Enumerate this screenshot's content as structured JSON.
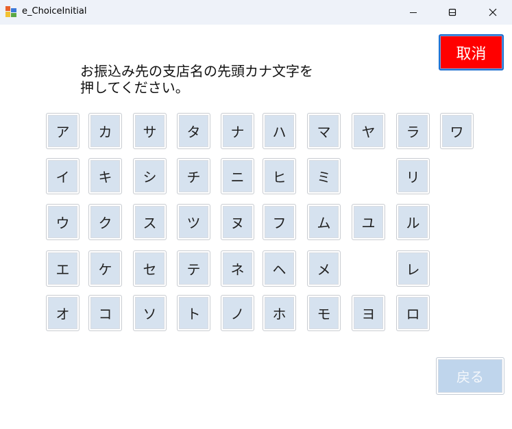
{
  "window": {
    "title": "e_ChoiceInitial"
  },
  "buttons": {
    "cancel": "取消",
    "back": "戻る"
  },
  "instruction": {
    "line1": "お振込み先の支店名の先頭カナ文字を",
    "line2": "押してください。"
  },
  "kana": {
    "a": "ア",
    "i": "イ",
    "u": "ウ",
    "e": "エ",
    "o": "オ",
    "ka": "カ",
    "ki": "キ",
    "ku": "ク",
    "ke": "ケ",
    "ko": "コ",
    "sa": "サ",
    "shi": "シ",
    "su": "ス",
    "se": "セ",
    "so": "ソ",
    "ta": "タ",
    "chi": "チ",
    "tsu": "ツ",
    "te": "テ",
    "to": "ト",
    "na": "ナ",
    "ni": "ニ",
    "nu": "ヌ",
    "ne": "ネ",
    "no": "ノ",
    "ha": "ハ",
    "hi": "ヒ",
    "fu": "フ",
    "he": "ヘ",
    "ho": "ホ",
    "ma": "マ",
    "mi": "ミ",
    "mu": "ム",
    "me": "メ",
    "mo": "モ",
    "ya": "ヤ",
    "yu": "ユ",
    "yo": "ヨ",
    "ra": "ラ",
    "ri": "リ",
    "ru": "ル",
    "re": "レ",
    "ro": "ロ",
    "wa": "ワ"
  },
  "colors": {
    "cancel_bg": "#ff0000",
    "kana_bg": "#d6e2ef",
    "back_bg": "#bfd5ec"
  }
}
